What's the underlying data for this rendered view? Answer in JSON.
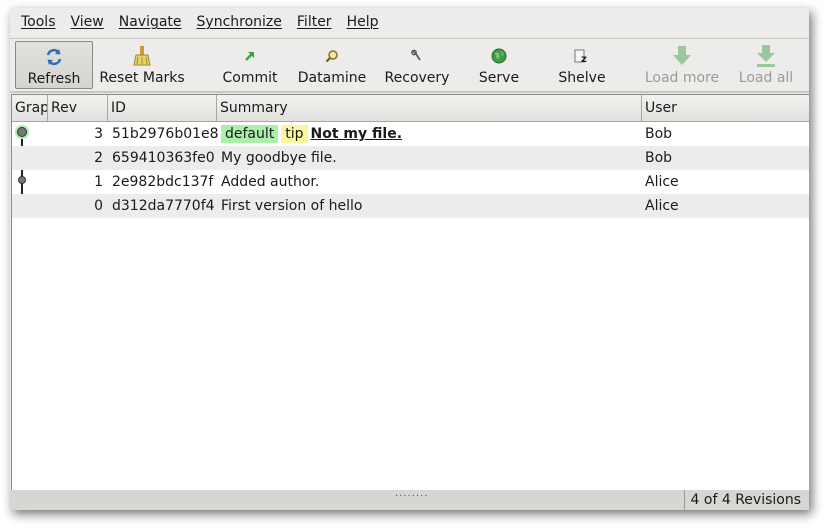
{
  "menu": [
    "Tools",
    "View",
    "Navigate",
    "Synchronize",
    "Filter",
    "Help"
  ],
  "toolbar": {
    "refresh": "Refresh",
    "reset_marks": "Reset Marks",
    "commit": "Commit",
    "datamine": "Datamine",
    "recovery": "Recovery",
    "serve": "Serve",
    "shelve": "Shelve",
    "load_more": "Load more",
    "load_all": "Load all"
  },
  "table": {
    "headers": [
      "Graph",
      "Rev",
      "ID",
      "Summary",
      "User"
    ],
    "rows": [
      {
        "rev": "3",
        "id": "51b2976b01e8",
        "branch_tag": "default",
        "tip_tag": "tip",
        "summary": "Not my file.",
        "user": "Bob"
      },
      {
        "rev": "2",
        "id": "659410363fe0",
        "summary": "My goodbye file.",
        "user": "Bob"
      },
      {
        "rev": "1",
        "id": "2e982bdc137f",
        "summary": "Added author.",
        "user": "Alice"
      },
      {
        "rev": "0",
        "id": "d312da7770f4",
        "summary": "First version of hello",
        "user": "Alice"
      }
    ]
  },
  "status": {
    "text": "4 of 4 Revisions",
    "grip": "........"
  },
  "colors": {
    "branch_tag_bg": "#aaf0aa",
    "tip_tag_bg": "#fdf6a0",
    "window_bg": "#edeceb",
    "alt_row_bg": "#ececec"
  }
}
